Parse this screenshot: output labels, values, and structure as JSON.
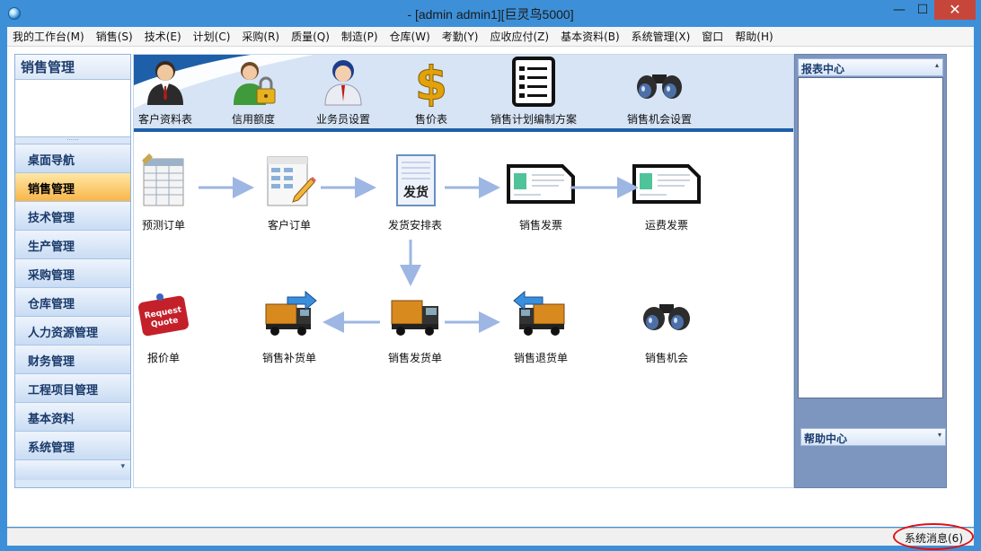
{
  "window": {
    "title": "-  [admin admin1][巨灵鸟5000]",
    "minimize": "—",
    "maximize": "☐",
    "close": "✕"
  },
  "menu": [
    "我的工作台(M)",
    "销售(S)",
    "技术(E)",
    "计划(C)",
    "采购(R)",
    "质量(Q)",
    "制造(P)",
    "仓库(W)",
    "考勤(Y)",
    "应收应付(Z)",
    "基本资料(B)",
    "系统管理(X)",
    "窗口",
    "帮助(H)"
  ],
  "sidebar": {
    "title": "销售管理",
    "splitter": "······",
    "items": [
      {
        "label": "桌面导航",
        "active": false
      },
      {
        "label": "销售管理",
        "active": true
      },
      {
        "label": "技术管理",
        "active": false
      },
      {
        "label": "生产管理",
        "active": false
      },
      {
        "label": "采购管理",
        "active": false
      },
      {
        "label": "仓库管理",
        "active": false
      },
      {
        "label": "人力资源管理",
        "active": false
      },
      {
        "label": "财务管理",
        "active": false
      },
      {
        "label": "工程项目管理",
        "active": false
      },
      {
        "label": "基本资料",
        "active": false
      },
      {
        "label": "系统管理",
        "active": false
      }
    ],
    "footer_caret": "▾"
  },
  "toolbar": {
    "items": [
      {
        "label": "客户资料表",
        "icon": "customer-person-icon"
      },
      {
        "label": "信用额度",
        "icon": "credit-lock-icon"
      },
      {
        "label": "业务员设置",
        "icon": "salesman-icon"
      },
      {
        "label": "售价表",
        "icon": "dollar-icon"
      },
      {
        "label": "销售计划编制方案",
        "icon": "checklist-icon"
      },
      {
        "label": "销售机会设置",
        "icon": "binoculars-icon"
      }
    ]
  },
  "flow": {
    "nodes": [
      {
        "label": "预测订单",
        "icon": "forecast-order-icon"
      },
      {
        "label": "客户订单",
        "icon": "customer-order-icon"
      },
      {
        "label": "发货安排表",
        "icon": "shipping-schedule-icon"
      },
      {
        "label": "销售发票",
        "icon": "sales-invoice-icon"
      },
      {
        "label": "运费发票",
        "icon": "freight-invoice-icon"
      },
      {
        "label": "报价单",
        "icon": "request-quote-icon",
        "icon_text": "Request Quote"
      },
      {
        "label": "销售补货单",
        "icon": "replenish-truck-icon"
      },
      {
        "label": "销售发货单",
        "icon": "delivery-truck-icon"
      },
      {
        "label": "销售退货单",
        "icon": "return-truck-icon"
      },
      {
        "label": "销售机会",
        "icon": "binoculars-icon"
      }
    ],
    "stamp_text": "发货"
  },
  "right_panel": {
    "report_title": "报表中心",
    "report_caret": "▴",
    "help_title": "帮助中心",
    "help_caret": "▾"
  },
  "status": {
    "message": "系统消息(6)"
  },
  "colors": {
    "accent": "#3d90d8",
    "active_item": "#f8b64a",
    "toolbar_bg": "#d6e4f5",
    "arrow": "#9db6e3",
    "highlight_ring": "#e01010"
  }
}
